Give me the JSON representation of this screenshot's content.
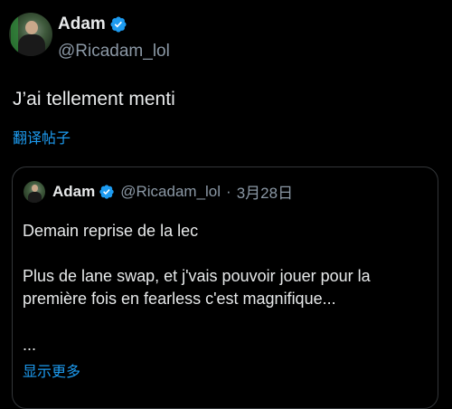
{
  "tweet": {
    "author_name": "Adam",
    "author_handle": "@Ricadam_lol",
    "text": "J’ai tellement menti",
    "translate_label": "翻译帖子"
  },
  "quoted": {
    "author_name": "Adam",
    "author_handle": "@Ricadam_lol",
    "separator": "·",
    "date": "3月28日",
    "line1": "Demain reprise de la lec",
    "line2": "Plus de lane swap, et j'vais pouvoir jouer pour la première fois en fearless c'est magnifique...",
    "ellipsis": "...",
    "show_more_label": "显示更多"
  },
  "icons": {
    "verified": "verified-badge-icon"
  },
  "colors": {
    "background": "#000000",
    "text": "#e7e9ea",
    "muted": "#8b98a5",
    "link": "#1d9bf0",
    "verified": "#1d9bf0",
    "border": "#333639"
  }
}
